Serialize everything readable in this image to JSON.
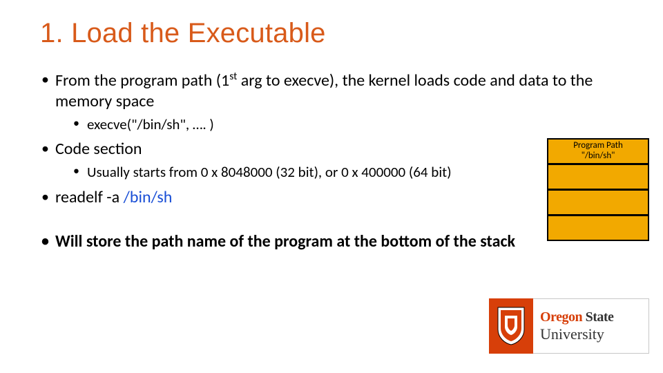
{
  "title": "1. Load the Executable",
  "bullets": {
    "b1_a": "From the program path (1",
    "b1_sup": "st",
    "b1_b": " arg to execve), the kernel loads code and data to the memory space",
    "b1_sub": "execve(\"/bin/sh\", …. )",
    "b2": "Code section",
    "b2_sub": "Usually starts from 0 x 8048000 (32 bit), or 0 x 400000 (64 bit)",
    "b3_a": "readelf -a ",
    "b3_link": "/bin/sh",
    "b4": "Will store the path name of the program at the bottom of the stack"
  },
  "stack": {
    "row0_a": "Program Path",
    "row0_b": "\"/bin/sh\"",
    "row1": "",
    "row2": "",
    "row3": ""
  },
  "logo": {
    "line1a": "Oregon",
    "line1b": "State",
    "line2": "University"
  }
}
